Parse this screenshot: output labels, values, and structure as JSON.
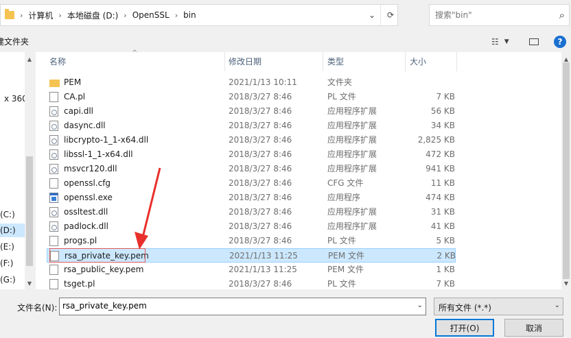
{
  "address": {
    "crumbs": [
      "计算机",
      "本地磁盘 (D:)",
      "OpenSSL",
      "bin"
    ],
    "separator": "›",
    "dropdown_icon": "chevron-down-icon",
    "refresh_icon": "refresh-icon"
  },
  "search": {
    "placeholder": "搜索\"bin\"",
    "icon": "search-icon"
  },
  "toolbar": {
    "new_folder": "建文件夹",
    "help": "?"
  },
  "nav": {
    "items": [
      {
        "label": "x 360"
      },
      {
        "label": "(C:)"
      },
      {
        "label": "(D:)",
        "selected": true
      },
      {
        "label": "(E:)"
      },
      {
        "label": "(F:)"
      },
      {
        "label": "(G:)"
      }
    ]
  },
  "columns": {
    "name": "名称",
    "date": "修改日期",
    "type": "类型",
    "size": "大小"
  },
  "files": [
    {
      "name": "PEM",
      "date": "2021/1/13 10:11",
      "type": "文件夹",
      "size": "",
      "icon": "folder"
    },
    {
      "name": "CA.pl",
      "date": "2018/3/27 8:46",
      "type": "PL 文件",
      "size": "7 KB",
      "icon": "file"
    },
    {
      "name": "capi.dll",
      "date": "2018/3/27 8:46",
      "type": "应用程序扩展",
      "size": "56 KB",
      "icon": "dll"
    },
    {
      "name": "dasync.dll",
      "date": "2018/3/27 8:46",
      "type": "应用程序扩展",
      "size": "34 KB",
      "icon": "dll"
    },
    {
      "name": "libcrypto-1_1-x64.dll",
      "date": "2018/3/27 8:46",
      "type": "应用程序扩展",
      "size": "2,825 KB",
      "icon": "dll"
    },
    {
      "name": "libssl-1_1-x64.dll",
      "date": "2018/3/27 8:46",
      "type": "应用程序扩展",
      "size": "472 KB",
      "icon": "dll"
    },
    {
      "name": "msvcr120.dll",
      "date": "2018/3/27 8:46",
      "type": "应用程序扩展",
      "size": "941 KB",
      "icon": "dll"
    },
    {
      "name": "openssl.cfg",
      "date": "2018/3/27 8:46",
      "type": "CFG 文件",
      "size": "11 KB",
      "icon": "file"
    },
    {
      "name": "openssl.exe",
      "date": "2018/3/27 8:46",
      "type": "应用程序",
      "size": "474 KB",
      "icon": "exe"
    },
    {
      "name": "ossltest.dll",
      "date": "2018/3/27 8:46",
      "type": "应用程序扩展",
      "size": "31 KB",
      "icon": "dll"
    },
    {
      "name": "padlock.dll",
      "date": "2018/3/27 8:46",
      "type": "应用程序扩展",
      "size": "41 KB",
      "icon": "dll"
    },
    {
      "name": "progs.pl",
      "date": "2018/3/27 8:46",
      "type": "PL 文件",
      "size": "5 KB",
      "icon": "file"
    },
    {
      "name": "rsa_private_key.pem",
      "date": "2021/1/13 11:25",
      "type": "PEM 文件",
      "size": "2 KB",
      "icon": "file",
      "selected": true
    },
    {
      "name": "rsa_public_key.pem",
      "date": "2021/1/13 11:25",
      "type": "PEM 文件",
      "size": "1 KB",
      "icon": "file"
    },
    {
      "name": "tsget.pl",
      "date": "2018/3/27 8:46",
      "type": "PL 文件",
      "size": "7 KB",
      "icon": "file"
    }
  ],
  "bottom": {
    "filename_label": "文件名(N):",
    "filename_value": "rsa_private_key.pem",
    "filetype_value": "所有文件 (*.*)",
    "open_label": "打开(O)",
    "cancel_label": "取消"
  },
  "colors": {
    "selection": "#cce8ff",
    "annotation": "#e8302c",
    "accent": "#0078d7"
  }
}
